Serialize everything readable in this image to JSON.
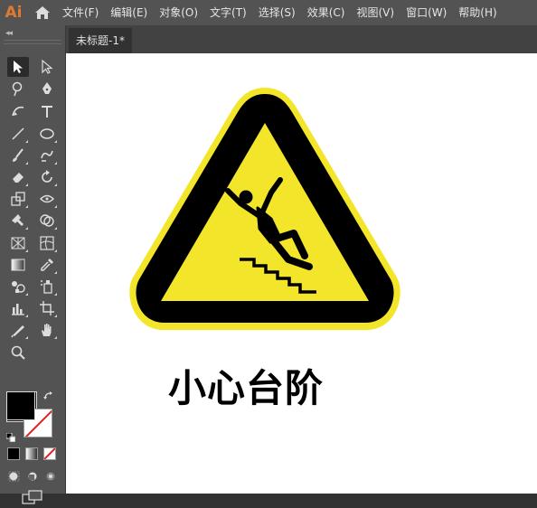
{
  "app": {
    "logo_text": "Ai"
  },
  "menu": [
    {
      "label": "文件(F)"
    },
    {
      "label": "编辑(E)"
    },
    {
      "label": "对象(O)"
    },
    {
      "label": "文字(T)"
    },
    {
      "label": "选择(S)"
    },
    {
      "label": "效果(C)"
    },
    {
      "label": "视图(V)"
    },
    {
      "label": "窗口(W)"
    },
    {
      "label": "帮助(H)"
    }
  ],
  "toolbar": {
    "collapse_glyph": "◂◂"
  },
  "document": {
    "tab_title": "未标题-1*"
  },
  "artwork": {
    "caption": "小心台阶",
    "colors": {
      "outer": "#F2E52A",
      "border": "#000000",
      "inner": "#F2E52A"
    }
  },
  "colors": {
    "menubar": "#535353",
    "panel": "#535353",
    "workspace": "#323232",
    "logo": "#E07A30"
  }
}
